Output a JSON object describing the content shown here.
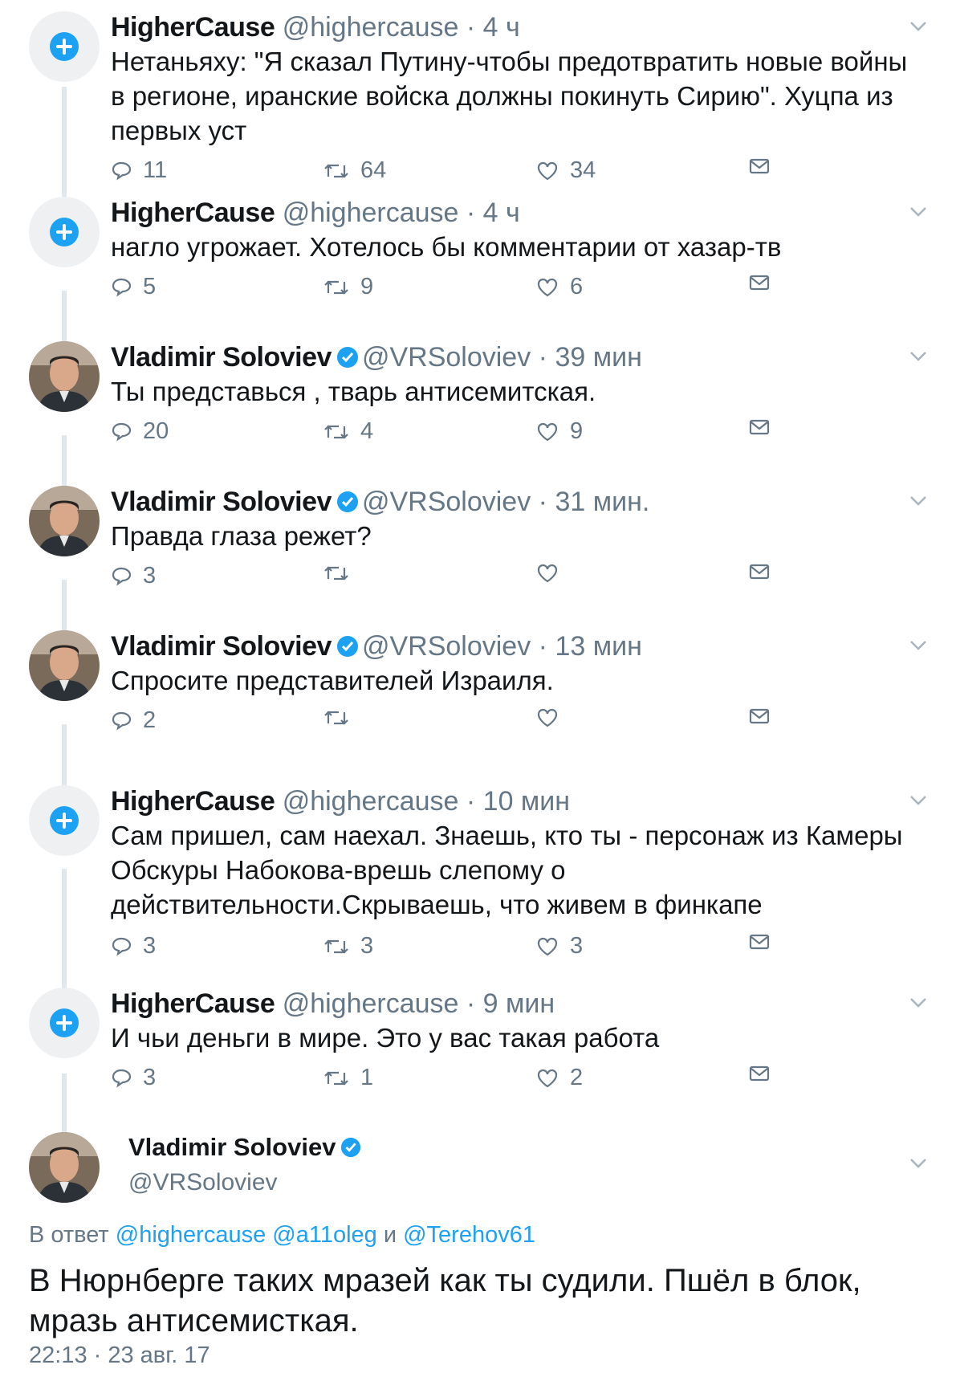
{
  "tweets": [
    {
      "name": "HigherCause",
      "handle": "@highercause",
      "sep": " · ",
      "time": "4 ч",
      "text": "Нетаньяху: \"Я сказал Путину-чтобы предотвратить новые войны в регионе, иранские войска должны покинуть Сирию\". Хуцпа из первых уст",
      "replies": "11",
      "retweets": "64",
      "likes": "34",
      "avatar": "plus",
      "verified": false
    },
    {
      "name": "HigherCause",
      "handle": "@highercause",
      "sep": " · ",
      "time": "4 ч",
      "text": "нагло угрожает. Хотелось бы комментарии от хазар-тв",
      "replies": "5",
      "retweets": "9",
      "likes": "6",
      "avatar": "plus",
      "verified": false
    },
    {
      "name": "Vladimir Soloviev",
      "handle": "@VRSoloviev",
      "sep": " · ",
      "time": "39 мин",
      "text": "Ты представься , тварь антисемитская.",
      "replies": "20",
      "retweets": "4",
      "likes": "9",
      "avatar": "photo",
      "verified": true
    },
    {
      "name": "Vladimir Soloviev",
      "handle": "@VRSoloviev",
      "sep": " · ",
      "time": "31 мин.",
      "text": "Правда глаза режет?",
      "replies": "3",
      "retweets": "",
      "likes": "",
      "avatar": "photo",
      "verified": true
    },
    {
      "name": "Vladimir Soloviev",
      "handle": "@VRSoloviev",
      "sep": " · ",
      "time": "13 мин",
      "text": "Спросите представителей Израиля.",
      "replies": "2",
      "retweets": "",
      "likes": "",
      "avatar": "photo",
      "verified": true
    },
    {
      "name": "HigherCause",
      "handle": "@highercause",
      "sep": " · ",
      "time": "10 мин",
      "text": "Сам пришел, сам наехал. Знаешь, кто ты - персонаж из Камеры Обскуры Набокова-врешь слепому о действительности.Скрываешь, что живем в финкапе",
      "replies": "3",
      "retweets": "3",
      "likes": "3",
      "avatar": "plus",
      "verified": false
    },
    {
      "name": "HigherCause",
      "handle": "@highercause",
      "sep": " · ",
      "time": "9 мин",
      "text": "И чьи деньги в мире. Это у вас такая работа",
      "replies": "3",
      "retweets": "1",
      "likes": "2",
      "avatar": "plus",
      "verified": false
    }
  ],
  "main_tweet": {
    "name": "Vladimir Soloviev",
    "handle": "@VRSoloviev",
    "reply_prefix": "В ответ ",
    "reply_user1": "@highercause",
    "reply_user2": "@a11oleg",
    "reply_and": " и ",
    "reply_user3": "@Terehov61",
    "text": "В Нюрнберге таких мразей как ты судили. Пшёл в блок, мразь антисемисткая.",
    "timestamp": "22:13 · 23 авг. 17"
  },
  "colors": {
    "accent": "#1da1f2",
    "muted": "#657786",
    "line": "#e1e8ed"
  },
  "icons": [
    "plus-icon",
    "verified-icon",
    "reply-icon",
    "retweet-icon",
    "like-icon",
    "dm-icon",
    "chevron-down-icon"
  ]
}
